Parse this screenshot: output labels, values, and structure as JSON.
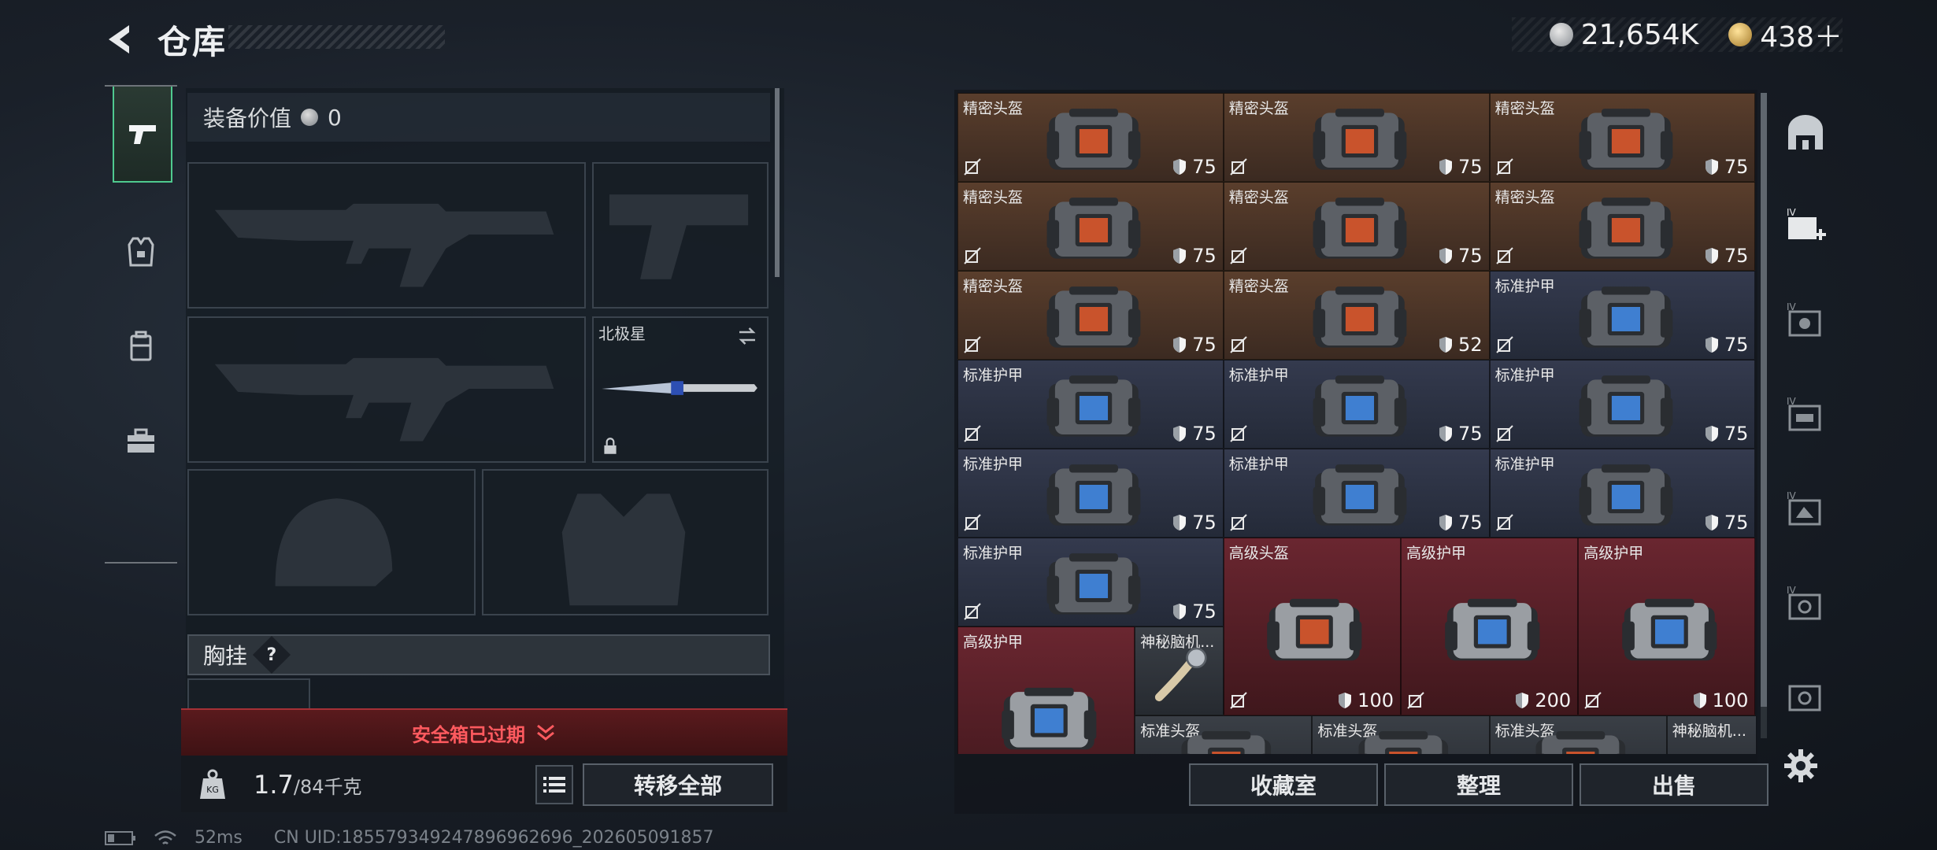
{
  "header": {
    "title": "仓库"
  },
  "currency": {
    "silver": "21,654K",
    "gold": "438＋"
  },
  "loadout": {
    "equip_value_label": "装备价值",
    "equip_value": "0",
    "knife_name": "北极星",
    "chest_rig_label": "胸挂",
    "chest_rig_help": "?",
    "safe_box_status": "安全箱已过期",
    "weight_current": "1.7",
    "weight_max": "/84千克",
    "transfer_all": "转移全部"
  },
  "storage": {
    "buttons": {
      "collection": "收藏室",
      "organize": "整理",
      "sell": "出售"
    },
    "items": [
      {
        "name": "精密头盔",
        "durability": "75",
        "kind": "helmet"
      },
      {
        "name": "精密头盔",
        "durability": "75",
        "kind": "helmet"
      },
      {
        "name": "精密头盔",
        "durability": "75",
        "kind": "helmet"
      },
      {
        "name": "精密头盔",
        "durability": "75",
        "kind": "helmet"
      },
      {
        "name": "精密头盔",
        "durability": "75",
        "kind": "helmet"
      },
      {
        "name": "精密头盔",
        "durability": "75",
        "kind": "helmet"
      },
      {
        "name": "精密头盔",
        "durability": "75",
        "kind": "helmet"
      },
      {
        "name": "精密头盔",
        "durability": "52",
        "kind": "helmet"
      },
      {
        "name": "标准护甲",
        "durability": "75",
        "kind": "armor"
      },
      {
        "name": "标准护甲",
        "durability": "75",
        "kind": "armor"
      },
      {
        "name": "标准护甲",
        "durability": "75",
        "kind": "armor"
      },
      {
        "name": "标准护甲",
        "durability": "75",
        "kind": "armor"
      },
      {
        "name": "标准护甲",
        "durability": "75",
        "kind": "armor"
      },
      {
        "name": "标准护甲",
        "durability": "75",
        "kind": "armor"
      },
      {
        "name": "标准护甲",
        "durability": "75",
        "kind": "armor"
      },
      {
        "name": "标准护甲",
        "durability": "75",
        "kind": "armor"
      },
      {
        "name": "高级头盔",
        "durability": "100",
        "kind": "red-helmet"
      },
      {
        "name": "高级护甲",
        "durability": "200",
        "kind": "red-armor"
      },
      {
        "name": "高级护甲",
        "durability": "100",
        "kind": "red-armor"
      },
      {
        "name": "高级护甲",
        "durability": "",
        "kind": "red-armor"
      },
      {
        "name": "神秘脑机...",
        "durability": "",
        "kind": "device"
      },
      {
        "name": "标准头盔",
        "durability": "",
        "kind": "std-helmet"
      },
      {
        "name": "标准头盔",
        "durability": "",
        "kind": "std-helmet"
      },
      {
        "name": "标准头盔",
        "durability": "",
        "kind": "std-helmet"
      },
      {
        "name": "神秘脑机...",
        "durability": "",
        "kind": "device"
      }
    ]
  },
  "status_bar": {
    "ping": "52ms",
    "uid": "CN UID:1855793492478969626​96_202605091857"
  }
}
